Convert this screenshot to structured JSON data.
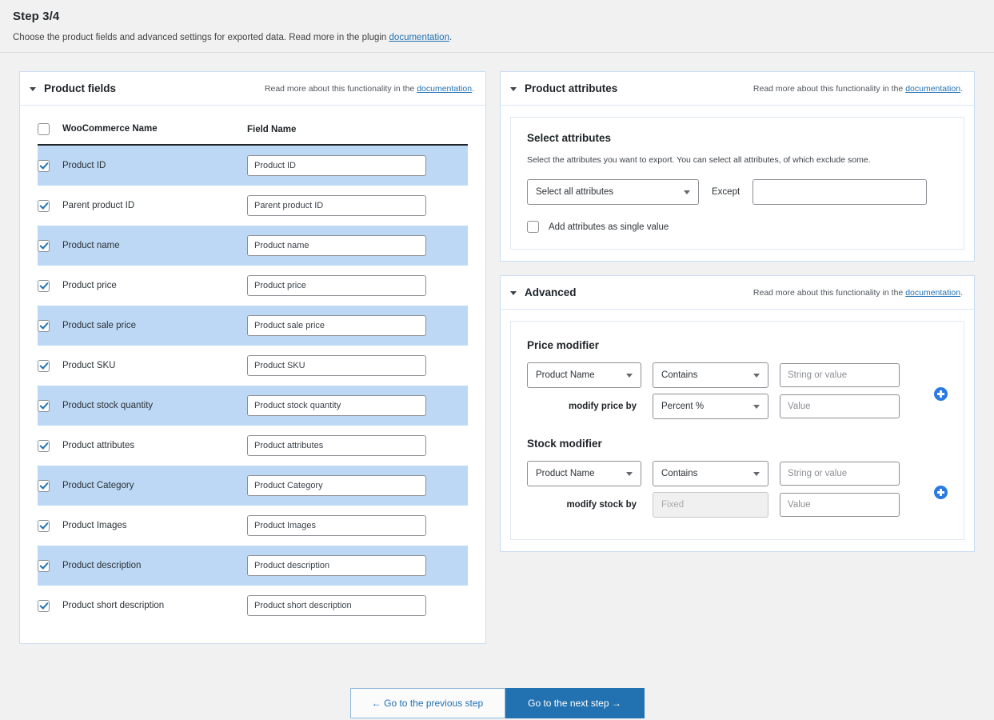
{
  "header": {
    "step_title": "Step 3/4",
    "desc_before": "Choose the product fields and advanced settings for exported data. Read more in the plugin ",
    "desc_link": "documentation",
    "desc_after": "."
  },
  "note": {
    "prefix": "Read more about this functionality in the ",
    "link": "documentation",
    "suffix": "."
  },
  "product_fields": {
    "panel_title": "Product fields",
    "columns": {
      "woocommerce_name": "WooCommerce Name",
      "field_name": "Field Name"
    },
    "select_all_checked": false,
    "rows": [
      {
        "name": "Product ID",
        "value": "Product ID",
        "checked": true
      },
      {
        "name": "Parent product ID",
        "value": "Parent product ID",
        "checked": true
      },
      {
        "name": "Product name",
        "value": "Product name",
        "checked": true
      },
      {
        "name": "Product price",
        "value": "Product price",
        "checked": true
      },
      {
        "name": "Product sale price",
        "value": "Product sale price",
        "checked": true
      },
      {
        "name": "Product SKU",
        "value": "Product SKU",
        "checked": true
      },
      {
        "name": "Product stock quantity",
        "value": "Product stock quantity",
        "checked": true
      },
      {
        "name": "Product attributes",
        "value": "Product attributes",
        "checked": true
      },
      {
        "name": "Product Category",
        "value": "Product Category",
        "checked": true
      },
      {
        "name": "Product Images",
        "value": "Product Images",
        "checked": true
      },
      {
        "name": "Product description",
        "value": "Product description",
        "checked": true
      },
      {
        "name": "Product short description",
        "value": "Product short description",
        "checked": true
      }
    ]
  },
  "product_attributes": {
    "panel_title": "Product attributes",
    "section_title": "Select attributes",
    "section_desc": "Select the attributes you want to export. You can select all attributes, of which exclude some.",
    "select_value": "Select all attributes",
    "except_label": "Except",
    "except_value": "",
    "except_placeholder": "",
    "single_value_label": "Add attributes as single value",
    "single_value_checked": false
  },
  "advanced": {
    "panel_title": "Advanced",
    "price_modifier": {
      "title": "Price modifier",
      "field_select": "Product Name",
      "operator_select": "Contains",
      "criteria_placeholder": "String or value",
      "criteria_value": "",
      "modify_label": "modify price by",
      "unit_select": "Percent %",
      "amount_placeholder": "Value",
      "amount_value": "",
      "add_icon": "plus-circle-icon"
    },
    "stock_modifier": {
      "title": "Stock modifier",
      "field_select": "Product Name",
      "operator_select": "Contains",
      "criteria_placeholder": "String or value",
      "criteria_value": "",
      "modify_label": "modify stock by",
      "unit_select": "Fixed",
      "unit_disabled": true,
      "amount_placeholder": "Value",
      "amount_value": "",
      "add_icon": "plus-circle-icon"
    }
  },
  "footer": {
    "previous_label": "← Go to the previous step",
    "next_label": "Go to the next step →"
  },
  "colors": {
    "accent": "#2271b1",
    "row_highlight": "#bdd8f4",
    "panel_border": "#c9ddf2",
    "plus": "#2a7ae2"
  }
}
